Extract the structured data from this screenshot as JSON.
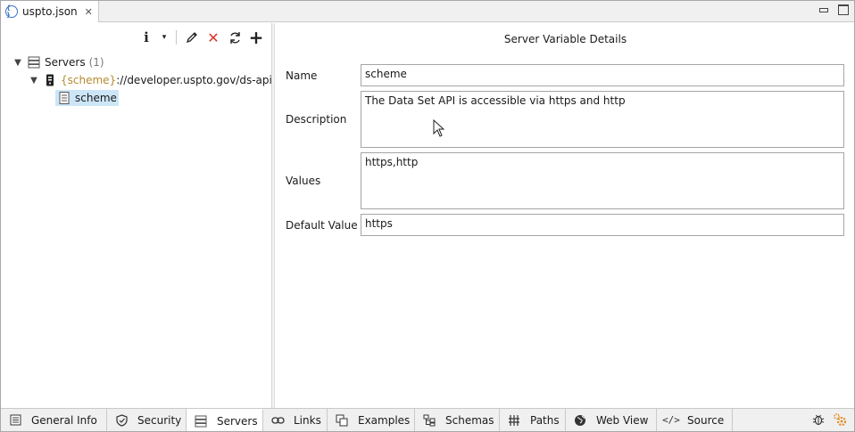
{
  "editor_tab": {
    "label": "uspto.json",
    "close_glyph": "✕",
    "icon": "api-icon"
  },
  "tree": {
    "servers": {
      "label": "Servers",
      "count": "(1)",
      "icon": "server-stack-icon"
    },
    "server_url": {
      "var_token": "{scheme}",
      "rest": "://developer.uspto.gov/ds-api",
      "icon": "server-icon"
    },
    "variable": {
      "label": "scheme",
      "icon": "document-lines-icon"
    }
  },
  "toolbar": {
    "info_glyph": "i",
    "dropdown_glyph": "▾",
    "edit_icon": "pencil-icon",
    "delete_glyph": "✕",
    "refresh_icon": "refresh-icon",
    "add_glyph": "+"
  },
  "details": {
    "title": "Server Variable Details",
    "name_label": "Name",
    "name_value": "scheme",
    "description_label": "Description",
    "description_value": "The Data Set API is accessible via https and http",
    "values_label": "Values",
    "values_value": "https,http",
    "default_label": "Default Value",
    "default_value": "https"
  },
  "bottom_tabs": [
    {
      "label": "General Info",
      "icon": "list-icon"
    },
    {
      "label": "Security",
      "icon": "shield-icon"
    },
    {
      "label": "Servers",
      "icon": "server-stack-icon"
    },
    {
      "label": "Links",
      "icon": "link-icon"
    },
    {
      "label": "Examples",
      "icon": "examples-icon"
    },
    {
      "label": "Schemas",
      "icon": "schema-icon"
    },
    {
      "label": "Paths",
      "icon": "paths-icon"
    },
    {
      "label": "Web View",
      "icon": "globe-icon"
    },
    {
      "label": "Source",
      "icon": "code-icon"
    }
  ],
  "active_bottom_tab": "Servers",
  "colors": {
    "accent": "#3b73c7",
    "selection": "#cde6f7",
    "delete": "#d9342b",
    "var_token": "#b58a2e",
    "warning": "#e08a1e"
  }
}
